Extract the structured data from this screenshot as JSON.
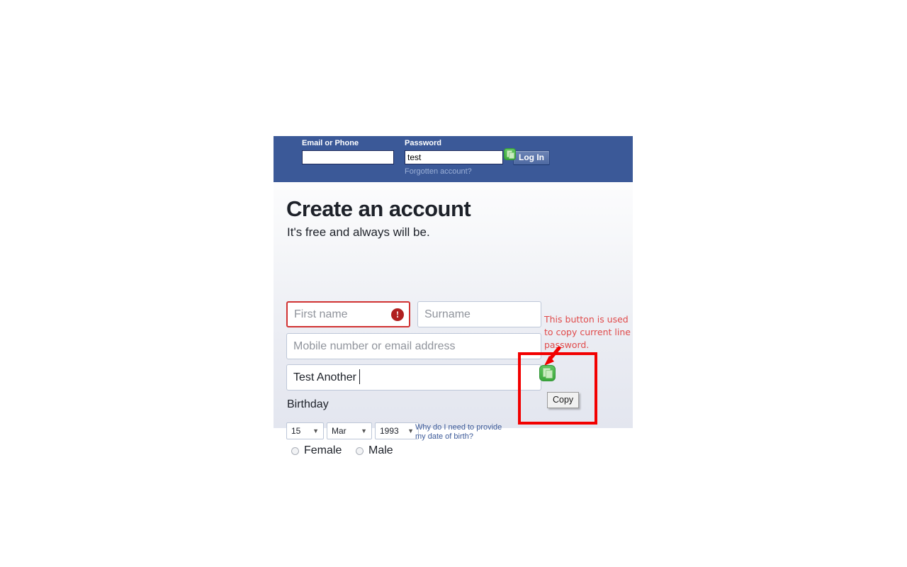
{
  "login_bar": {
    "email_label": "Email or Phone",
    "email_value": "",
    "email_placeholder": "",
    "password_label": "Password",
    "password_value": "test",
    "password_placeholder": "",
    "forgot_link": "Forgotten account?",
    "login_button": "Log In",
    "copy_icon_name": "copy-icon",
    "bar_color": "#3b5998",
    "button_color": "#4e69a2",
    "link_color": "#9cb0d7"
  },
  "signup": {
    "title": "Create an account",
    "subtitle": "It's free and always will be.",
    "fields": {
      "first_name_placeholder": "First name",
      "first_name_value": "",
      "first_name_error": "!",
      "surname_placeholder": "Surname",
      "surname_value": "",
      "mobile_placeholder": "Mobile number or email address",
      "mobile_value": "",
      "another_value": "Test Another",
      "another_placeholder": ""
    },
    "birthday": {
      "label": "Birthday",
      "day": "15",
      "month": "Mar",
      "year": "1993",
      "caret": "▼",
      "help_link": "Why do I need to provide my date of birth?"
    },
    "gender": {
      "female": "Female",
      "male": "Male"
    },
    "error_color": "#d13232",
    "link_color": "#3b5998"
  },
  "annotation": {
    "text": "This button is used to copy current line password.",
    "tooltip": "Copy",
    "box_color": "#f20000",
    "text_color": "#e04a4a",
    "arrow_name": "red-arrow-icon"
  }
}
